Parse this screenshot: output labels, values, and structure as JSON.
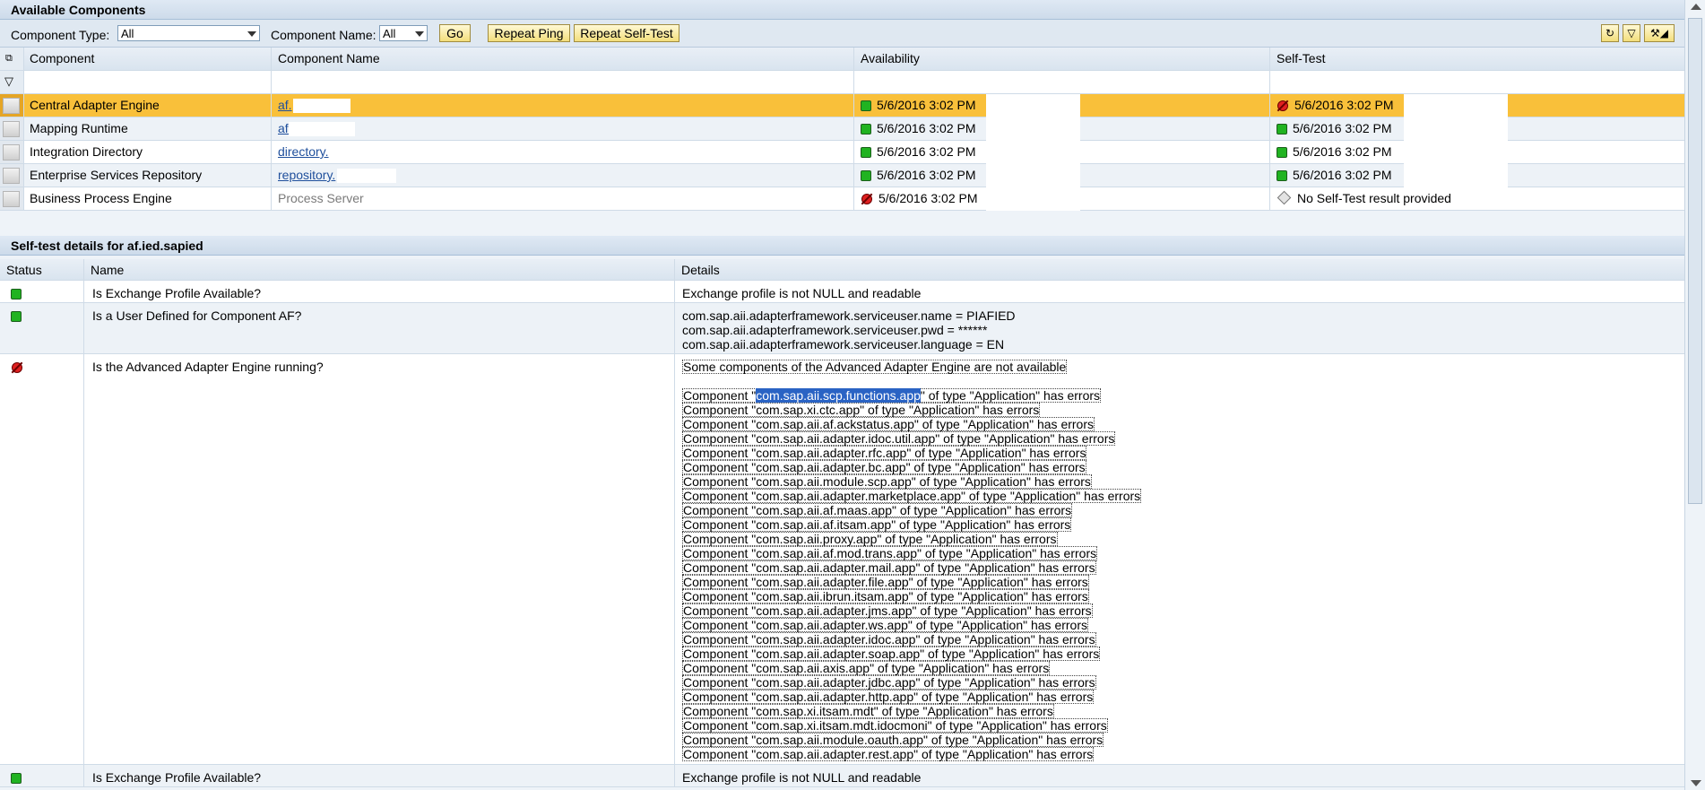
{
  "available": {
    "title": "Available Components",
    "toolbar": {
      "component_type_label": "Component Type:",
      "component_type_value": "All",
      "component_name_label": "Component Name:",
      "component_name_value": "All",
      "go": "Go",
      "repeat_ping": "Repeat Ping",
      "repeat_selftest": "Repeat Self-Test"
    },
    "columns": [
      "Component",
      "Component Name",
      "Availability",
      "Self-Test"
    ],
    "rows": [
      {
        "component": "Central Adapter Engine",
        "name": "af.",
        "availability": "5/6/2016 3:02 PM",
        "availability_status": "ok",
        "selftest": "5/6/2016 3:02 PM",
        "selftest_status": "error"
      },
      {
        "component": "Mapping Runtime",
        "name": "af.",
        "availability": "5/6/2016 3:02 PM",
        "availability_status": "ok",
        "selftest": "5/6/2016 3:02 PM",
        "selftest_status": "ok"
      },
      {
        "component": "Integration Directory",
        "name": "directory.",
        "availability": "5/6/2016 3:02 PM",
        "availability_status": "ok",
        "selftest": "5/6/2016 3:02 PM",
        "selftest_status": "ok"
      },
      {
        "component": "Enterprise Services Repository",
        "name": "repository.",
        "availability": "5/6/2016 3:02 PM",
        "availability_status": "ok",
        "selftest": "5/6/2016 3:02 PM",
        "selftest_status": "ok"
      },
      {
        "component": "Business Process Engine",
        "name": "Process Server",
        "availability": "5/6/2016 3:02 PM",
        "availability_status": "error",
        "selftest": "No Self-Test result provided",
        "selftest_status": "none"
      }
    ]
  },
  "details": {
    "title": "Self-test details for af.ied.sapied",
    "columns": [
      "Status",
      "Name",
      "Details"
    ],
    "rows": [
      {
        "status": "ok",
        "name": "Is Exchange Profile Available?",
        "lines": [
          "Exchange profile is not NULL and readable"
        ]
      },
      {
        "status": "ok",
        "name": "Is a User Defined for Component AF?",
        "lines": [
          "com.sap.aii.adapterframework.serviceuser.name = PIAFIED",
          "com.sap.aii.adapterframework.serviceuser.pwd = ******",
          "com.sap.aii.adapterframework.serviceuser.language = EN"
        ]
      },
      {
        "status": "error",
        "name": "Is the Advanced Adapter Engine running?",
        "summary": "Some components of the Advanced Adapter Engine are not available",
        "first_prefix": "Component \"",
        "first_selected": "com.sap.aii.scp.functions.app",
        "first_suffix": "\" of type \"Application\" has errors",
        "errors": [
          "Component \"com.sap.xi.ctc.app\" of type \"Application\" has errors",
          "Component \"com.sap.aii.af.ackstatus.app\" of type \"Application\" has errors",
          "Component \"com.sap.aii.adapter.idoc.util.app\" of type \"Application\" has errors",
          "Component \"com.sap.aii.adapter.rfc.app\" of type \"Application\" has errors",
          "Component \"com.sap.aii.adapter.bc.app\" of type \"Application\" has errors",
          "Component \"com.sap.aii.module.scp.app\" of type \"Application\" has errors",
          "Component \"com.sap.aii.adapter.marketplace.app\" of type \"Application\" has errors",
          "Component \"com.sap.aii.af.maas.app\" of type \"Application\" has errors",
          "Component \"com.sap.aii.af.itsam.app\" of type \"Application\" has errors",
          "Component \"com.sap.aii.proxy.app\" of type \"Application\" has errors",
          "Component \"com.sap.aii.af.mod.trans.app\" of type \"Application\" has errors",
          "Component \"com.sap.aii.adapter.mail.app\" of type \"Application\" has errors",
          "Component \"com.sap.aii.adapter.file.app\" of type \"Application\" has errors",
          "Component \"com.sap.aii.ibrun.itsam.app\" of type \"Application\" has errors",
          "Component \"com.sap.aii.adapter.jms.app\" of type \"Application\" has errors",
          "Component \"com.sap.aii.adapter.ws.app\" of type \"Application\" has errors",
          "Component \"com.sap.aii.adapter.idoc.app\" of type \"Application\" has errors",
          "Component \"com.sap.aii.adapter.soap.app\" of type \"Application\" has errors",
          "Component \"com.sap.aii.axis.app\" of type \"Application\" has errors",
          "Component \"com.sap.aii.adapter.jdbc.app\" of type \"Application\" has errors",
          "Component \"com.sap.aii.adapter.http.app\" of type \"Application\" has errors",
          "Component \"com.sap.xi.itsam.mdt\" of type \"Application\" has errors",
          "Component \"com.sap.xi.itsam.mdt.idocmoni\" of type \"Application\" has errors",
          "Component \"com.sap.aii.module.oauth.app\" of type \"Application\" has errors",
          "Component \"com.sap.aii.adapter.rest.app\" of type \"Application\" has errors"
        ]
      },
      {
        "status": "ok",
        "name": "Is Exchange Profile Available?",
        "lines": [
          "Exchange profile is not NULL and readable"
        ]
      }
    ]
  },
  "icons": {
    "refresh": "refresh-icon",
    "filter": "filter-icon",
    "settings": "settings-icon"
  },
  "colors": {
    "selected_row": "#f9c03a",
    "ok": "#21b321",
    "error": "#e02020",
    "link": "#1f4f9c"
  }
}
